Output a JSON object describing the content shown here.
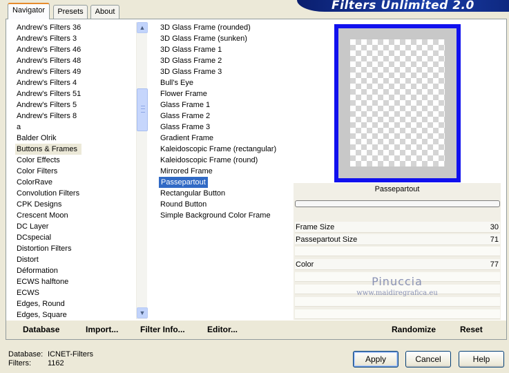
{
  "app": {
    "title": "Filters Unlimited 2.0"
  },
  "tabs": [
    {
      "label": "Navigator"
    },
    {
      "label": "Presets"
    },
    {
      "label": "About"
    }
  ],
  "categories": {
    "items": [
      "Andrew's Filters 36",
      "Andrew's Filters 3",
      "Andrew's Filters 46",
      "Andrew's Filters 48",
      "Andrew's Filters 49",
      "Andrew's Filters 4",
      "Andrew's Filters 51",
      "Andrew's Filters 5",
      "Andrew's Filters 8",
      "a",
      "Balder Olrik",
      "Buttons & Frames",
      "Color Effects",
      "Color Filters",
      "ColorRave",
      "Convolution Filters",
      "CPK Designs",
      "Crescent Moon",
      "DC Layer",
      "DCspecial",
      "Distortion Filters",
      "Distort",
      "Déformation",
      "ECWS halftone",
      "ECWS",
      "Edges, Round",
      "Edges, Square"
    ],
    "selected": "Buttons & Frames"
  },
  "filters": {
    "items": [
      "3D Glass Frame (rounded)",
      "3D Glass Frame (sunken)",
      "3D Glass Frame 1",
      "3D Glass Frame 2",
      "3D Glass Frame 3",
      "Bull's Eye",
      "Flower Frame",
      "Glass Frame 1",
      "Glass Frame 2",
      "Glass Frame 3",
      "Gradient Frame",
      "Kaleidoscopic Frame (rectangular)",
      "Kaleidoscopic Frame (round)",
      "Mirrored Frame",
      "Passepartout",
      "Rectangular Button",
      "Round Button",
      "Simple Background Color Frame"
    ],
    "selected": "Passepartout"
  },
  "preview": {
    "filter_name": "Passepartout",
    "params": [
      {
        "label": "Frame Size",
        "value": "30"
      },
      {
        "label": "Passepartout Size",
        "value": "71"
      },
      {
        "label": "Color",
        "value": "77"
      }
    ],
    "watermark_name": "Pinuccia",
    "watermark_site": "www.maidiregrafica.eu",
    "frame_color": "#1010ee",
    "mat_color": "#c8c8c8"
  },
  "toolbar": {
    "database": "Database",
    "import": "Import...",
    "filter_info": "Filter Info...",
    "editor": "Editor...",
    "randomize": "Randomize",
    "reset": "Reset"
  },
  "footer": {
    "database_label": "Database:",
    "database_value": "ICNET-Filters",
    "filters_label": "Filters:",
    "filters_value": "1162",
    "apply": "Apply",
    "cancel": "Cancel",
    "help": "Help"
  }
}
